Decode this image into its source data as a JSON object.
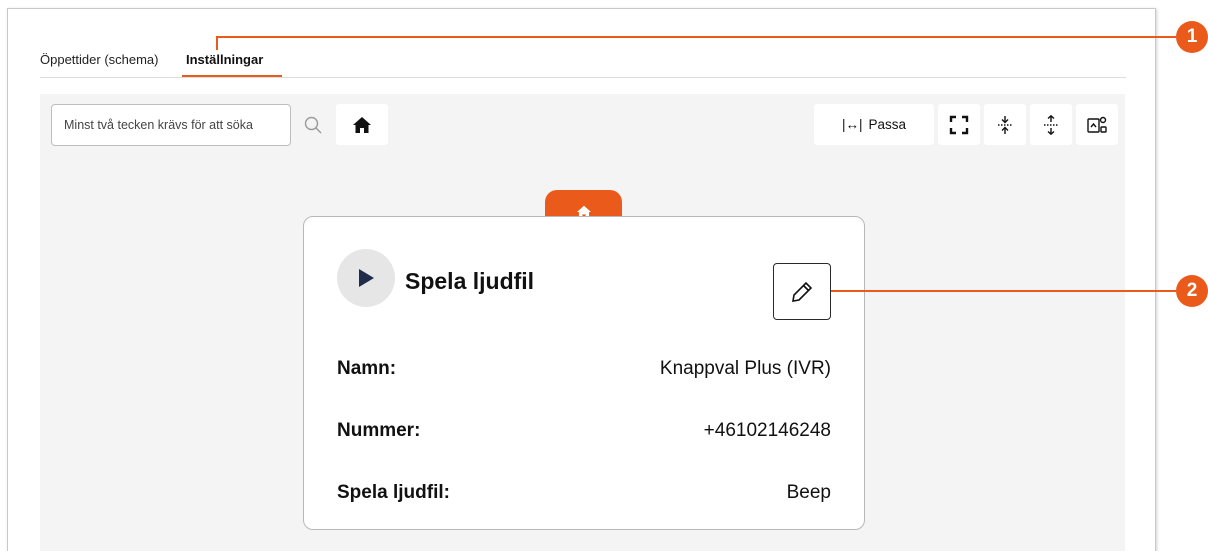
{
  "tabs": [
    {
      "label": "Öppettider (schema)",
      "active": false
    },
    {
      "label": "Inställningar",
      "active": true
    }
  ],
  "toolbar": {
    "search_placeholder": "Minst två tecken krävs för att söka",
    "fit_label": "Passa",
    "fit_symbol": "|↔|",
    "icons": [
      "search-icon",
      "home-icon",
      "fullscreen-icon",
      "collapse-vertical-icon",
      "expand-vertical-icon",
      "export-image-icon"
    ]
  },
  "node": {
    "title": "Spela ljudfil",
    "fields": [
      {
        "label": "Namn:",
        "value": "Knappval Plus (IVR)"
      },
      {
        "label": "Nummer:",
        "value": "+46102146248"
      },
      {
        "label": "Spela ljudfil:",
        "value": "Beep"
      }
    ]
  },
  "callouts": [
    "1",
    "2"
  ],
  "colors": {
    "accent": "#ea5a1a",
    "canvas": "#f4f4f4",
    "play_circle": "#e6e6e6",
    "play_triangle": "#1f2c4a"
  }
}
